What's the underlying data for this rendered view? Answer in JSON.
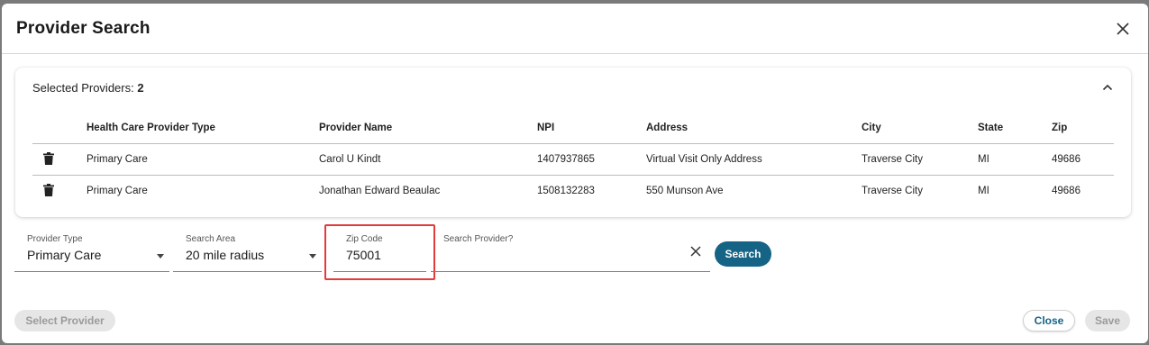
{
  "dialog": {
    "title": "Provider Search",
    "close_icon": "close-icon"
  },
  "selected": {
    "label": "Selected Providers: ",
    "count": "2",
    "toggle_icon": "chevron-up-icon"
  },
  "table": {
    "headers": [
      "Health Care Provider Type",
      "Provider Name",
      "NPI",
      "Address",
      "City",
      "State",
      "Zip"
    ],
    "rows": [
      [
        "Primary Care",
        "Carol U Kindt",
        "1407937865",
        "Virtual Visit Only Address",
        "Traverse City",
        "MI",
        "49686"
      ],
      [
        "Primary Care",
        "Jonathan Edward Beaulac",
        "1508132283",
        "550 Munson Ave",
        "Traverse City",
        "MI",
        "49686"
      ]
    ],
    "row_icon": "trash-icon"
  },
  "filters": {
    "provider_type": {
      "label": "Provider Type",
      "value": "Primary Care"
    },
    "search_area": {
      "label": "Search Area",
      "value": "20 mile radius"
    },
    "zip_code": {
      "label": "Zip Code",
      "value": "75001"
    },
    "search_provider": {
      "label": "Search Provider?",
      "value": ""
    },
    "clear_icon": "clear-icon",
    "search_label": "Search",
    "highlight_color": "#e23b3b"
  },
  "footer": {
    "select_provider": "Select Provider",
    "close": "Close",
    "save": "Save"
  },
  "colors": {
    "primary": "#156385",
    "disabled_bg": "#e6e6e6",
    "disabled_text": "#9a9a9a"
  }
}
